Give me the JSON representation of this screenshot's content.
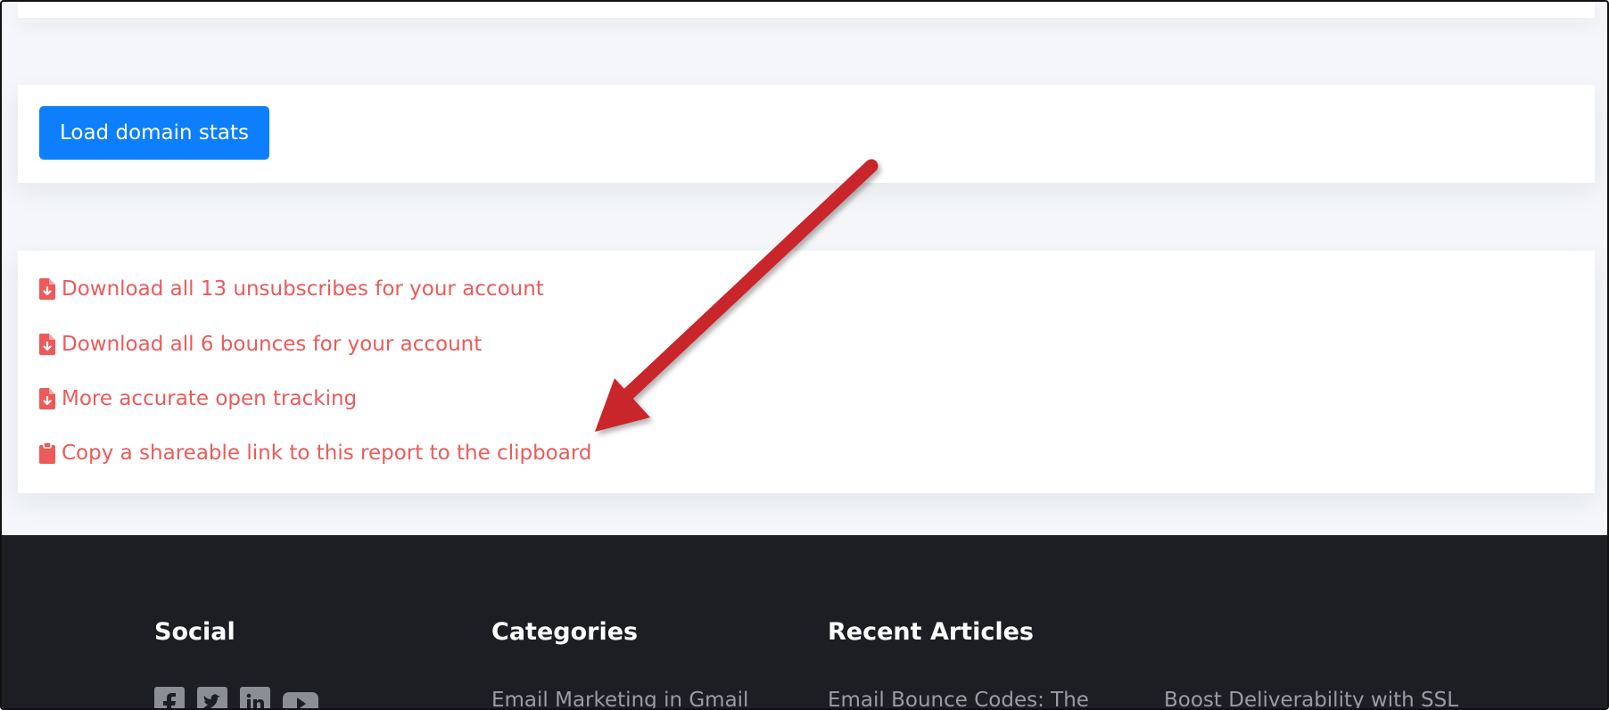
{
  "actions": {
    "load_stats_label": "Load domain stats"
  },
  "links": [
    {
      "label": "Download all 13 unsubscribes for your account",
      "icon": "file-download-icon"
    },
    {
      "label": "Download all 6 bounces for your account",
      "icon": "file-download-icon"
    },
    {
      "label": "More accurate open tracking",
      "icon": "file-download-icon"
    },
    {
      "label": "Copy a shareable link to this report to the clipboard",
      "icon": "clipboard-icon"
    }
  ],
  "footer": {
    "social_heading": "Social",
    "categories_heading": "Categories",
    "recent_heading": "Recent Articles",
    "social_icons": [
      "facebook-icon",
      "twitter-icon",
      "linkedin-icon",
      "youtube-icon"
    ],
    "category_item": "Email Marketing in Gmail",
    "recent_item_1": "Email Bounce Codes: The",
    "recent_item_2": "Boost Deliverability with SSL"
  },
  "colors": {
    "primary": "#0d7ffc",
    "link": "#ec5a5a",
    "footer_bg": "#1d1e23",
    "annotation": "#c8262b"
  }
}
